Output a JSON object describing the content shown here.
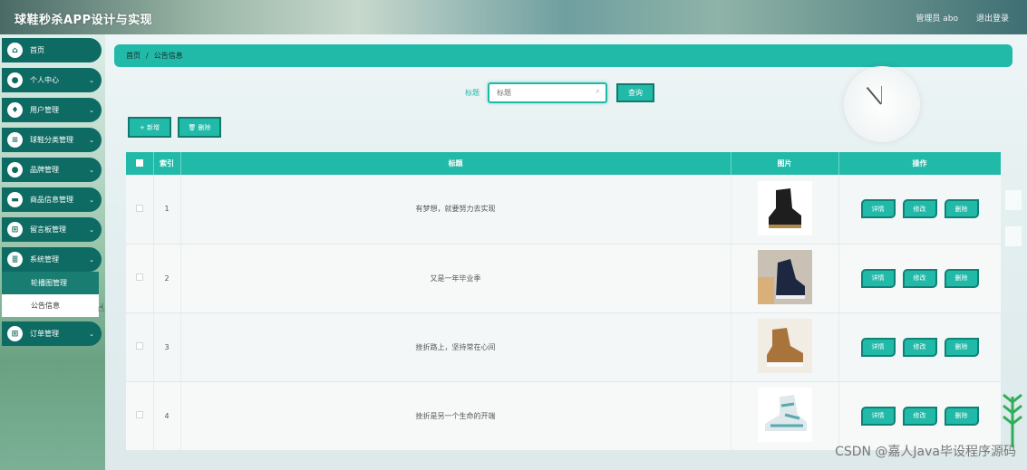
{
  "header": {
    "app_title": "球鞋秒杀APP设计与实现",
    "user_info": "管理员 abo",
    "logout": "退出登录"
  },
  "sidebar": {
    "items": [
      {
        "label": "首页",
        "icon": "home-icon",
        "caret": ""
      },
      {
        "label": "个人中心",
        "icon": "user-icon",
        "caret": "⌄"
      },
      {
        "label": "用户管理",
        "icon": "shield-icon",
        "caret": "⌄"
      },
      {
        "label": "球鞋分类管理",
        "icon": "menu-icon",
        "caret": "⌄"
      },
      {
        "label": "品牌管理",
        "icon": "pin-icon",
        "caret": "⌄"
      },
      {
        "label": "商品信息管理",
        "icon": "briefcase-icon",
        "caret": "⌄"
      },
      {
        "label": "留言板管理",
        "icon": "grid-icon",
        "caret": "⌄"
      },
      {
        "label": "系统管理",
        "icon": "sliders-icon",
        "caret": "⌄"
      },
      {
        "label": "订单管理",
        "icon": "grid-icon",
        "caret": "⌄"
      }
    ],
    "submenu": [
      "轮播图管理",
      "公告信息"
    ]
  },
  "breadcrumb": {
    "home": "首页",
    "separator": "/",
    "current": "公告信息"
  },
  "search": {
    "label": "标题",
    "placeholder": "标题",
    "button": "查询"
  },
  "toolbar": {
    "add": "+ 新增",
    "delete": "🗑 删除"
  },
  "table": {
    "headers": [
      "",
      "索引",
      "标题",
      "图片",
      "操作"
    ],
    "rows": [
      {
        "index": "1",
        "title": "有梦想，就要努力去实现",
        "shoe": "black"
      },
      {
        "index": "2",
        "title": "又是一年毕业季",
        "shoe": "navy"
      },
      {
        "index": "3",
        "title": "挫折路上，坚持常在心间",
        "shoe": "tan"
      },
      {
        "index": "4",
        "title": "挫折是另一个生命的开端",
        "shoe": "white"
      }
    ],
    "ops": [
      "详情",
      "修改",
      "删除"
    ]
  },
  "watermark": "CSDN @嘉人Java毕设程序源码",
  "colors": {
    "accent": "#21b9a8",
    "sidebar_item": "#0e6b63"
  }
}
